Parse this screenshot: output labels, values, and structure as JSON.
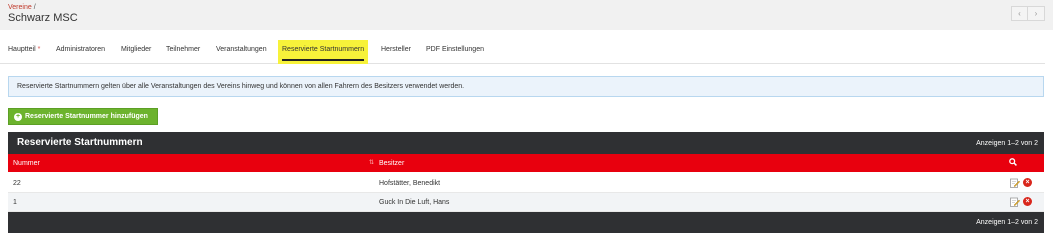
{
  "breadcrumb": {
    "parent": "Vereine",
    "separator": "/"
  },
  "page_title": "Schwarz MSC",
  "pager": {
    "prev": "‹",
    "next": "›"
  },
  "tabs": [
    {
      "label": "Hauptteil",
      "required_marker": "*"
    },
    {
      "label": "Administratoren"
    },
    {
      "label": "Mitglieder"
    },
    {
      "label": "Teilnehmer"
    },
    {
      "label": "Veranstaltungen"
    },
    {
      "label": "Reservierte Startnummern",
      "active": true
    },
    {
      "label": "Hersteller"
    },
    {
      "label": "PDF Einstellungen"
    }
  ],
  "info_text": "Reservierte Startnummern gelten über alle Veranstaltungen des Vereins hinweg und können von allen Fahrern des Besitzers verwendet werden.",
  "add_button": {
    "label": "Reservierte Startnummer hinzufügen",
    "icon": "plus-circle-icon"
  },
  "table": {
    "title": "Reservierte Startnummern",
    "count_text": "Anzeigen 1–2 von 2",
    "columns": [
      "Nummer",
      "Besitzer"
    ],
    "rows": [
      {
        "nummer": "22",
        "besitzer": "Hofstätter, Benedikt"
      },
      {
        "nummer": "1",
        "besitzer": "Guck In Die Luft, Hans"
      }
    ],
    "footer_count_text": "Anzeigen 1–2 von 2"
  },
  "colors": {
    "accent_red": "#e8000e",
    "header_dark": "#2f3033",
    "add_green": "#6cb32d",
    "active_tab_highlight": "#f7f23a",
    "info_bg": "#ebf3fb"
  }
}
